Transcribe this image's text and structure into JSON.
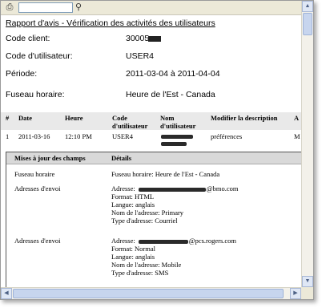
{
  "toolbar": {
    "search_value": "",
    "print_icon": "printer-icon",
    "find_icon": "binoculars-icon"
  },
  "report": {
    "title": "Rapport d'avis - Vérification des activités des utilisateurs",
    "fields": [
      {
        "label": "Code client:",
        "value": "30005"
      },
      {
        "label": "Code d'utilisateur:",
        "value": "USER4"
      },
      {
        "label": "Période:",
        "value": "2011-03-04 à 2011-04-04"
      },
      {
        "label": "Fuseau horaire:",
        "value": "Heure de l'Est - Canada"
      }
    ]
  },
  "table": {
    "headers": {
      "num": "#",
      "date": "Date",
      "heure": "Heure",
      "code1": "Code",
      "code2": "d'utilisateur",
      "nom1": "Nom",
      "nom2": "d'utilisateur",
      "desc": "Modifier la description",
      "a": "A"
    },
    "row": {
      "num": "1",
      "date": "2011-03-16",
      "heure": "12:10 PM",
      "code": "USER4",
      "desc": "préférences",
      "a": "M"
    }
  },
  "details": {
    "headers": {
      "col1": "Mises à jour des champs",
      "col2": "Détails"
    },
    "rows": [
      {
        "field": "Fuseau horaire",
        "lines": [
          "Fuseau horaire: Heure de l'Est - Canada"
        ]
      },
      {
        "field": "Adresses d'envoi",
        "lines": [
          "Adresse:",
          "@bmo.com",
          "Format:  HTML",
          "Langue:  anglais",
          "Nom de l'adresse:  Primary",
          "Type d'adresse:  Courriel"
        ]
      },
      {
        "field": "Adresses d'envoi",
        "lines": [
          "Adresse:",
          "@pcs.rogers.com",
          "Format:  Normal",
          "Langue:  anglais",
          "Nom de l'adresse:  Mobile",
          "Type d'adresse:  SMS"
        ]
      }
    ]
  },
  "scroll": {
    "up": "▲",
    "down": "▼",
    "left": "◀",
    "right": "▶"
  }
}
